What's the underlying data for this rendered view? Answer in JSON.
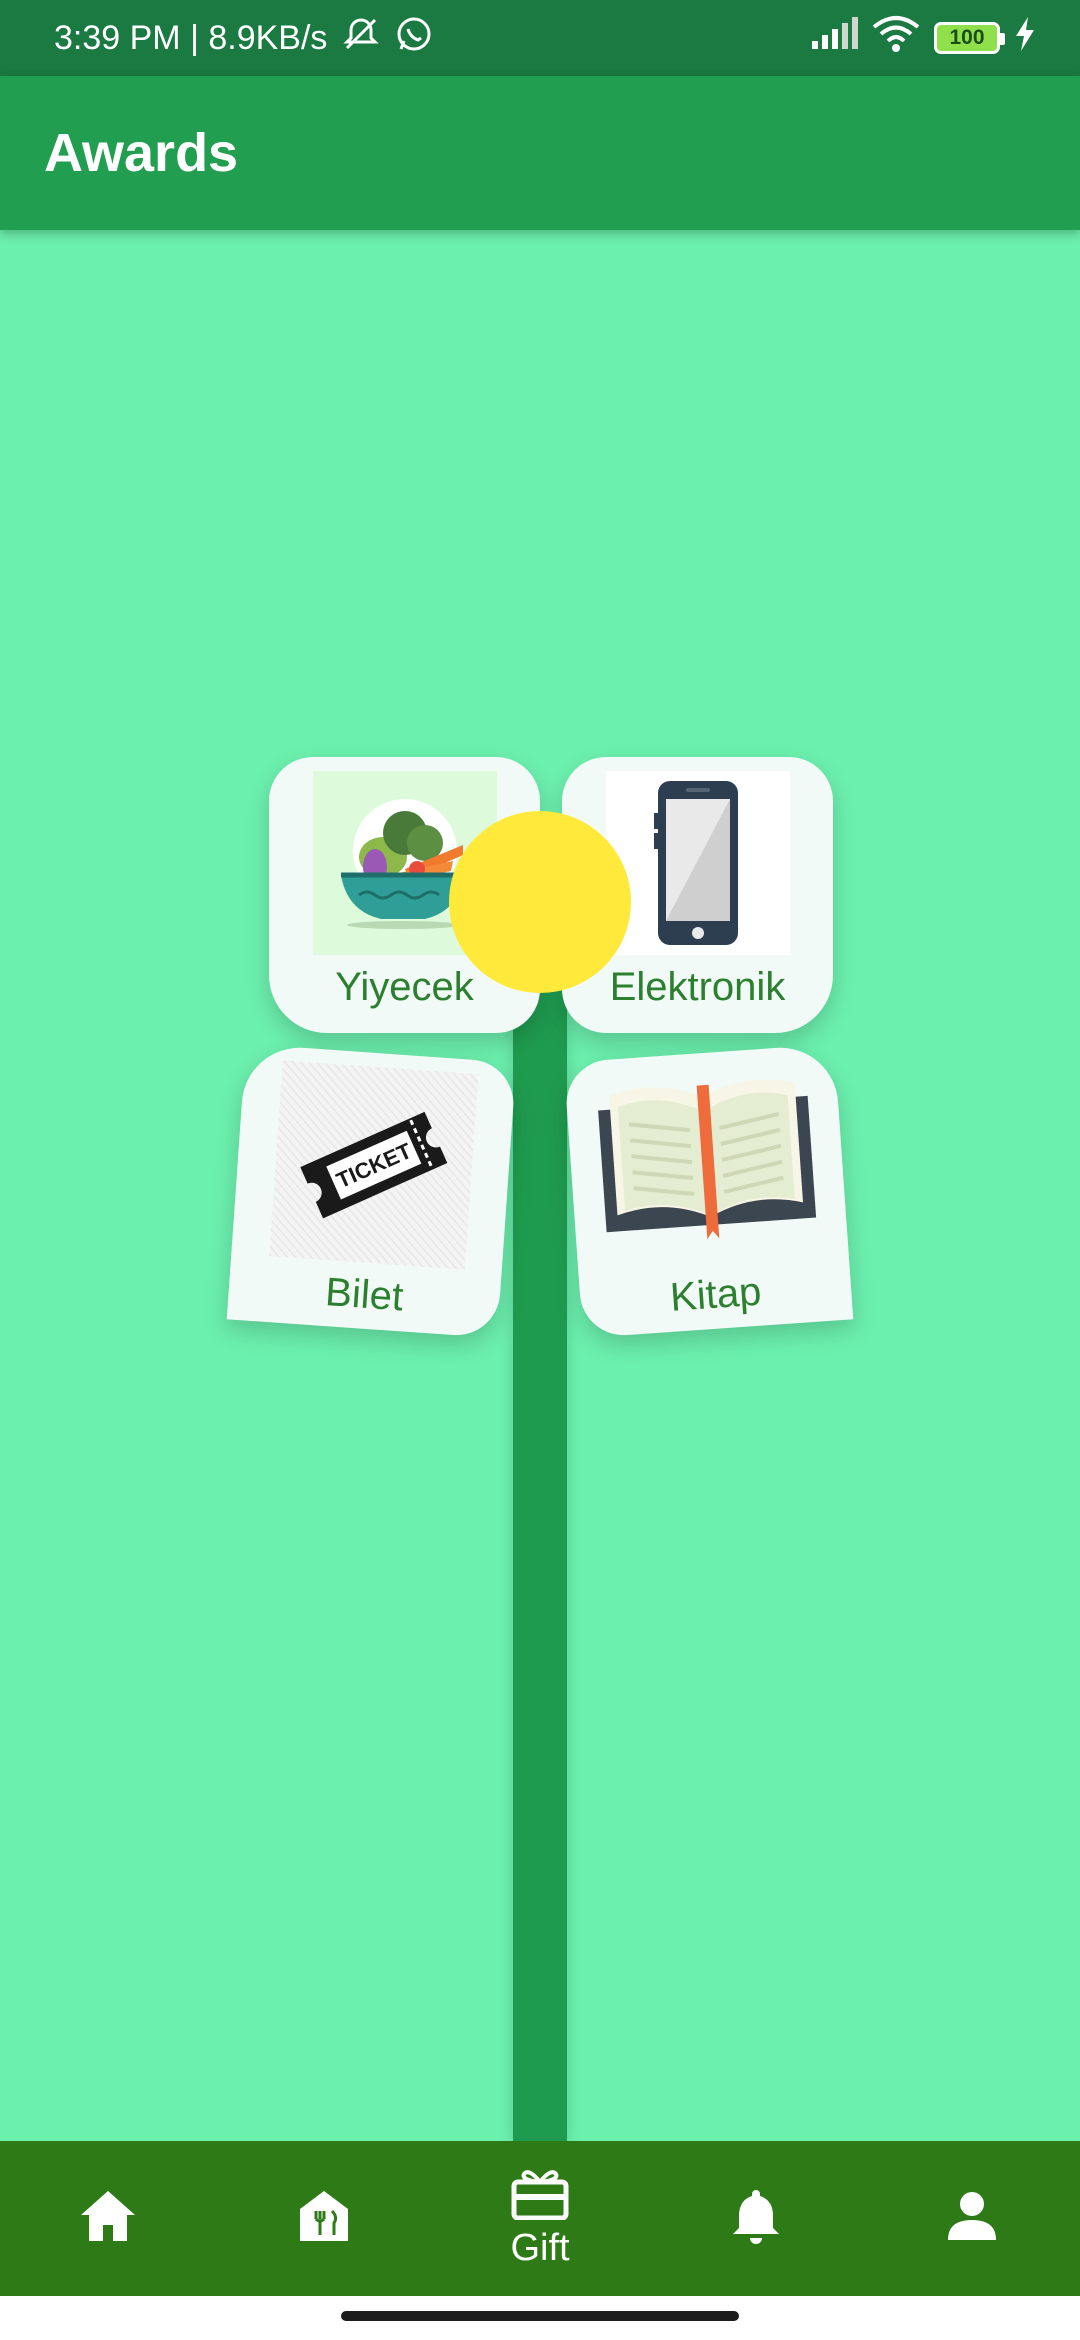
{
  "status_bar": {
    "time_and_speed": "3:39 PM | 8.9KB/s",
    "battery": "100"
  },
  "app_bar": {
    "title": "Awards"
  },
  "categories": [
    {
      "label": "Yiyecek",
      "icon": "vegetable-basket-icon"
    },
    {
      "label": "Elektronik",
      "icon": "smartphone-icon"
    },
    {
      "label": "Bilet",
      "icon": "ticket-icon",
      "ticket_text": "TICKET"
    },
    {
      "label": "Kitap",
      "icon": "open-book-icon"
    }
  ],
  "bottom_nav": {
    "items": [
      {
        "icon": "home-icon",
        "label": ""
      },
      {
        "icon": "restaurant-icon",
        "label": ""
      },
      {
        "icon": "gift-icon",
        "label": "Gift",
        "active": true
      },
      {
        "icon": "bell-icon",
        "label": ""
      },
      {
        "icon": "person-icon",
        "label": ""
      }
    ]
  },
  "colors": {
    "background": "#6cf0ae",
    "app_bar": "#219e4f",
    "status_bar": "#1a7a42",
    "stem": "#1f9b4f",
    "flower_center": "#ffe93b",
    "bottom_nav": "#2e7a17",
    "label_text": "#2b7f2f"
  }
}
